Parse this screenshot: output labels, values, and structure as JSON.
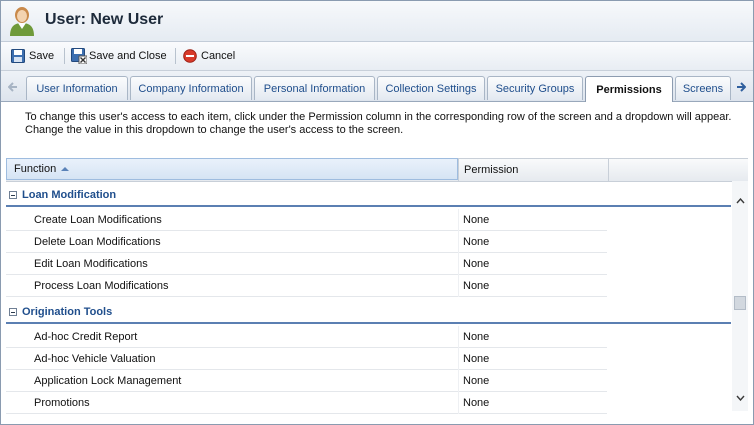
{
  "window": {
    "title": "User: New User"
  },
  "toolbar": {
    "save_label": "Save",
    "save_close_label": "Save and Close",
    "cancel_label": "Cancel"
  },
  "tabs": [
    {
      "label": "User Information"
    },
    {
      "label": "Company Information"
    },
    {
      "label": "Personal Information"
    },
    {
      "label": "Collection Settings"
    },
    {
      "label": "Security Groups"
    },
    {
      "label": "Permissions",
      "active": true
    },
    {
      "label": "Screens"
    }
  ],
  "instructions": "To change this user's access to each item, click under the Permission column in the corresponding row of the screen and a dropdown will appear. Change the value in this dropdown to change the user's access to the screen.",
  "grid": {
    "columns": {
      "function": "Function",
      "permission": "Permission"
    },
    "groups": [
      {
        "name": "Loan Modification",
        "rows": [
          {
            "function": "Create Loan Modifications",
            "permission": "None"
          },
          {
            "function": "Delete Loan Modifications",
            "permission": "None"
          },
          {
            "function": "Edit Loan Modifications",
            "permission": "None"
          },
          {
            "function": "Process Loan Modifications",
            "permission": "None"
          }
        ]
      },
      {
        "name": "Origination Tools",
        "rows": [
          {
            "function": "Ad-hoc Credit Report",
            "permission": "None"
          },
          {
            "function": "Ad-hoc Vehicle Valuation",
            "permission": "None"
          },
          {
            "function": "Application Lock Management",
            "permission": "None"
          },
          {
            "function": "Promotions",
            "permission": "None"
          }
        ]
      }
    ]
  },
  "colors": {
    "accent": "#1f4e8c",
    "group_rule": "#5b7fb2",
    "cancel_red": "#d83a2a"
  }
}
